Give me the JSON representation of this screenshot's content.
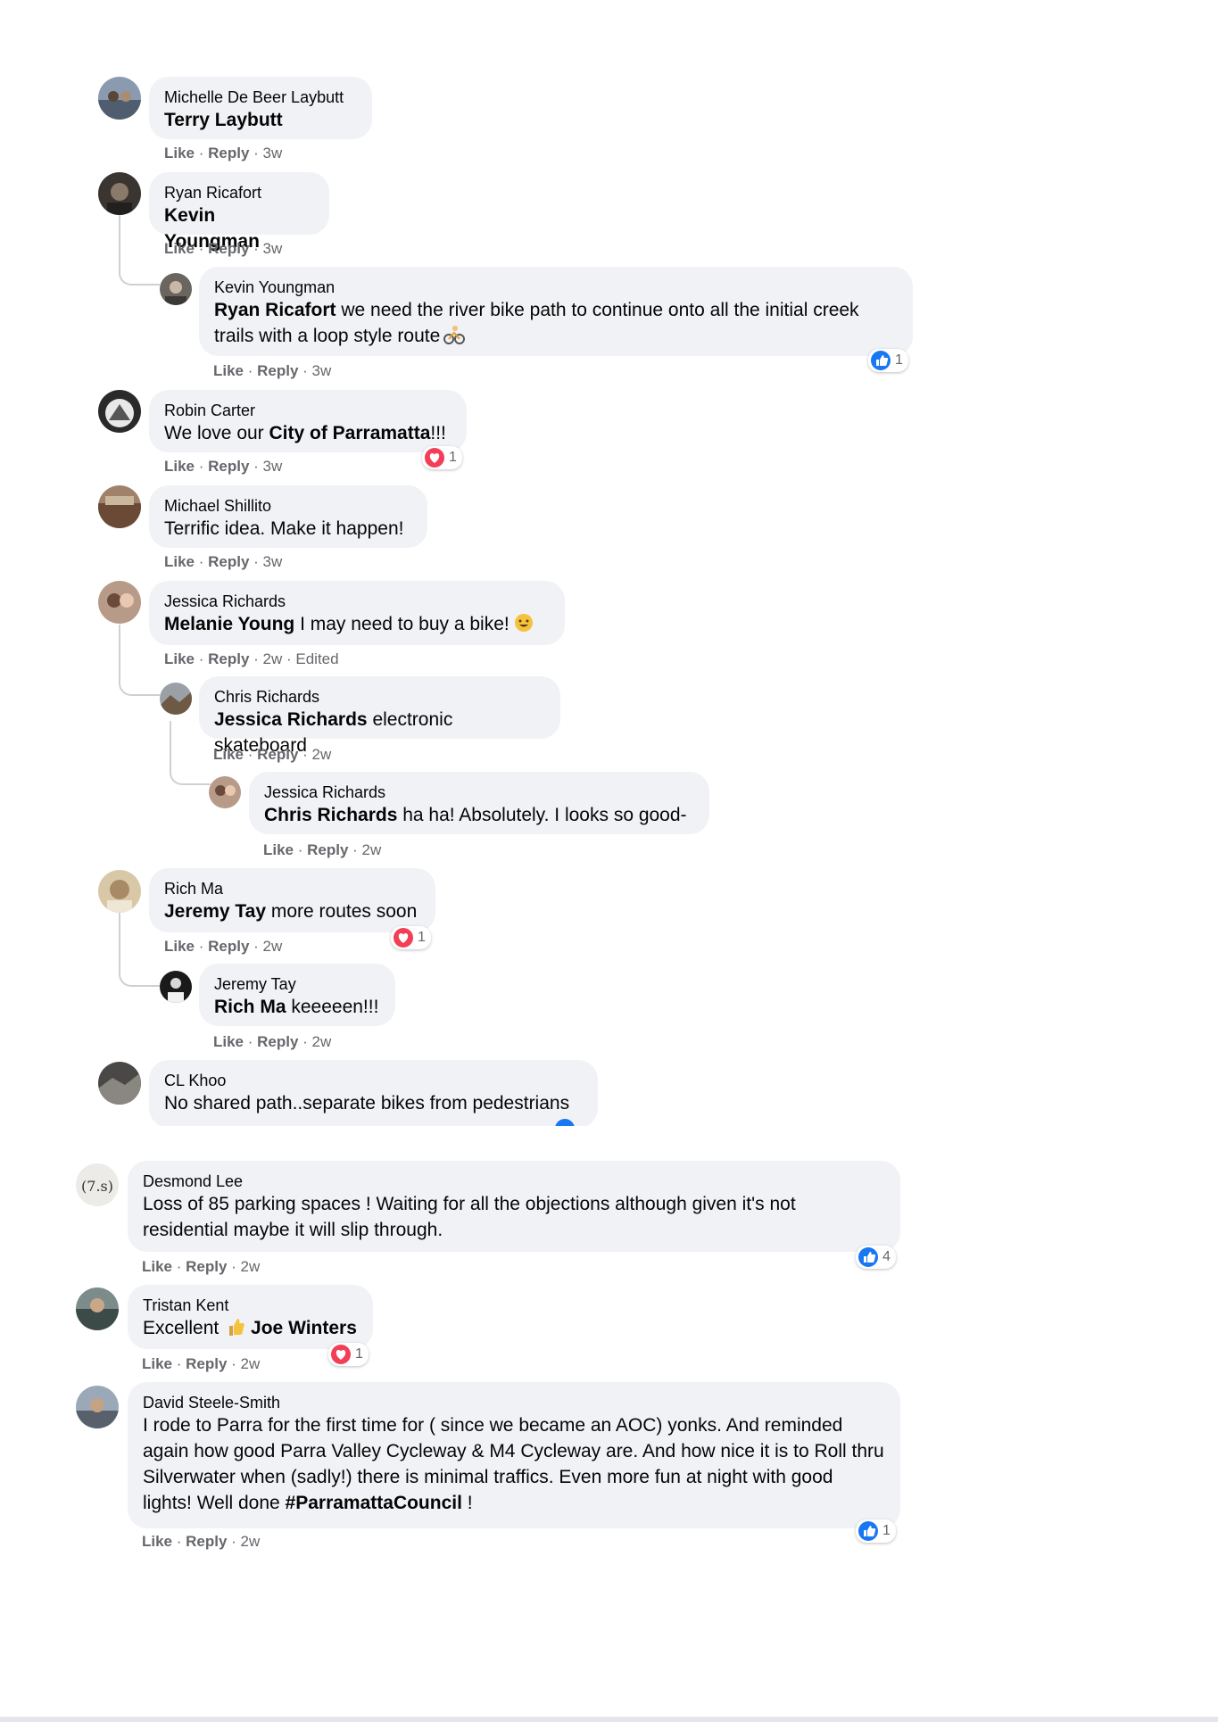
{
  "actions": {
    "like": "Like",
    "reply": "Reply",
    "sep": " · "
  },
  "comments": [
    {
      "author": "Michelle De Beer Laybutt",
      "mention": "Terry Laybutt",
      "text": "",
      "time": "3w"
    },
    {
      "author": "Ryan Ricafort",
      "mention": "Kevin Youngman",
      "text": "",
      "time": "3w"
    },
    {
      "author": "Kevin Youngman",
      "mention": "Ryan Ricafort",
      "text": " we need the river bike path to continue onto all the initial creek trails with a loop style route",
      "emoji": "cyclist-emoji",
      "time": "3w",
      "reaction": {
        "icon": "like-icon",
        "count": "1"
      }
    },
    {
      "author": "Robin Carter",
      "pre": "We love our ",
      "mention": "City of Parramatta",
      "text": "!!!",
      "time": "3w",
      "reaction": {
        "icon": "love-icon",
        "count": "1"
      }
    },
    {
      "author": "Michael Shillito",
      "text": "Terrific idea. Make it happen!",
      "time": "3w"
    },
    {
      "author": "Jessica Richards",
      "mention": "Melanie Young",
      "text": " I may need to buy a bike!",
      "emoji": "grin-emoji",
      "time": "2w",
      "edited": "Edited"
    },
    {
      "author": "Chris Richards",
      "mention": "Jessica Richards",
      "text": " electronic skateboard",
      "time": "2w"
    },
    {
      "author": "Jessica Richards",
      "mention": "Chris Richards",
      "text": " ha ha! Absolutely. I looks so good-",
      "time": "2w"
    },
    {
      "author": "Rich Ma",
      "mention": "Jeremy Tay",
      "text": " more routes soon",
      "time": "2w",
      "reaction": {
        "icon": "love-icon",
        "count": "1"
      }
    },
    {
      "author": "Jeremy Tay",
      "mention": "Rich Ma",
      "text": " keeeeen!!!",
      "time": "2w"
    },
    {
      "author": "CL Khoo",
      "text": "No shared path..separate bikes from pedestrians",
      "time": ""
    },
    {
      "author": "Desmond Lee",
      "text": "Loss of 85 parking spaces ! Waiting for all the objections although given it's not residential maybe it will slip through.",
      "time": "2w",
      "reaction": {
        "icon": "like-icon",
        "count": "4"
      }
    },
    {
      "author": "Tristan Kent",
      "pre": "Excellent ",
      "emoji_mid": "thumbs-up-emoji",
      "mention": "Joe Winters",
      "text": "",
      "time": "2w",
      "reaction": {
        "icon": "love-icon",
        "count": "1"
      }
    },
    {
      "author": "David Steele-Smith",
      "text": "I rode to Parra for the first time for ( since we became an AOC) yonks. And reminded again how good Parra Valley Cycleway & M4 Cycleway are. And how nice it is to Roll thru Silverwater when (sadly!) there is minimal traffics. Even more fun at night with good lights! Well done ",
      "mention_end": "#ParramattaCouncil",
      "text_end": " !",
      "time": "2w",
      "reaction": {
        "icon": "like-icon",
        "count": "1"
      }
    }
  ],
  "colors": {
    "bubble": "#f0f2f5",
    "meta": "#65676b",
    "like_blue": "#1877f2",
    "love_red": "#f33e58"
  }
}
